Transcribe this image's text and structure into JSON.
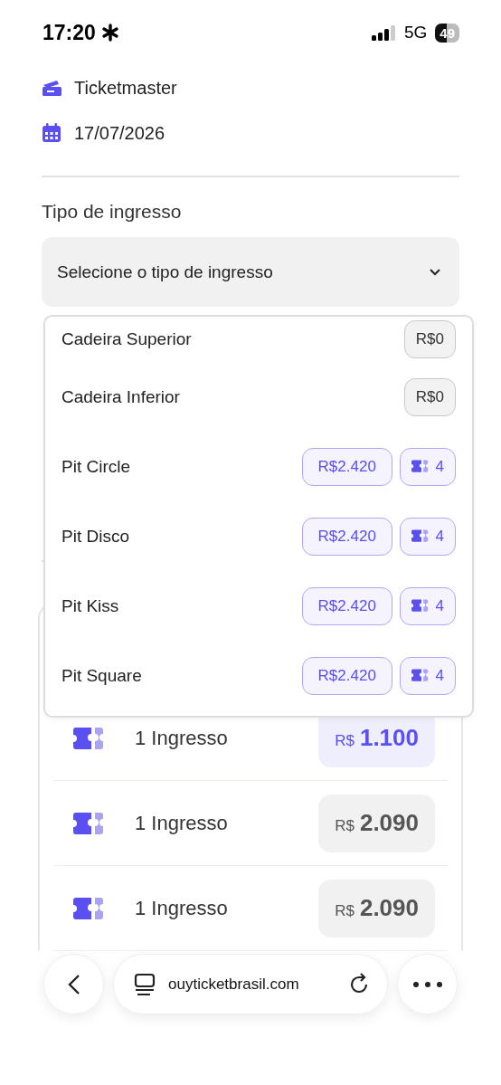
{
  "status_bar": {
    "time": "17:20",
    "network": "5G",
    "battery": "49"
  },
  "event": {
    "organizer": "Ticketmaster",
    "date": "17/07/2026"
  },
  "ticket_type": {
    "label": "Tipo de ingresso",
    "placeholder": "Selecione o tipo de ingresso"
  },
  "dropdown_options": [
    {
      "name": "Cadeira Superior",
      "price": "R$0",
      "kind": "free"
    },
    {
      "name": "Cadeira Inferior",
      "price": "R$0",
      "kind": "free"
    },
    {
      "name": "Pit Circle",
      "price": "R$2.420",
      "count": "4",
      "kind": "pit"
    },
    {
      "name": "Pit Disco",
      "price": "R$2.420",
      "count": "4",
      "kind": "pit"
    },
    {
      "name": "Pit Kiss",
      "price": "R$2.420",
      "count": "4",
      "kind": "pit"
    },
    {
      "name": "Pit Square",
      "price": "R$2.420",
      "count": "4",
      "kind": "pit"
    }
  ],
  "ticket_rows": [
    {
      "label": "1 Ingresso",
      "currency": "R$",
      "amount": "1.100",
      "selected": true
    },
    {
      "label": "1 Ingresso",
      "currency": "R$",
      "amount": "2.090",
      "selected": false
    },
    {
      "label": "1 Ingresso",
      "currency": "R$",
      "amount": "2.090",
      "selected": false
    }
  ],
  "browser_bar": {
    "url": "ouyticketbrasil.com"
  }
}
